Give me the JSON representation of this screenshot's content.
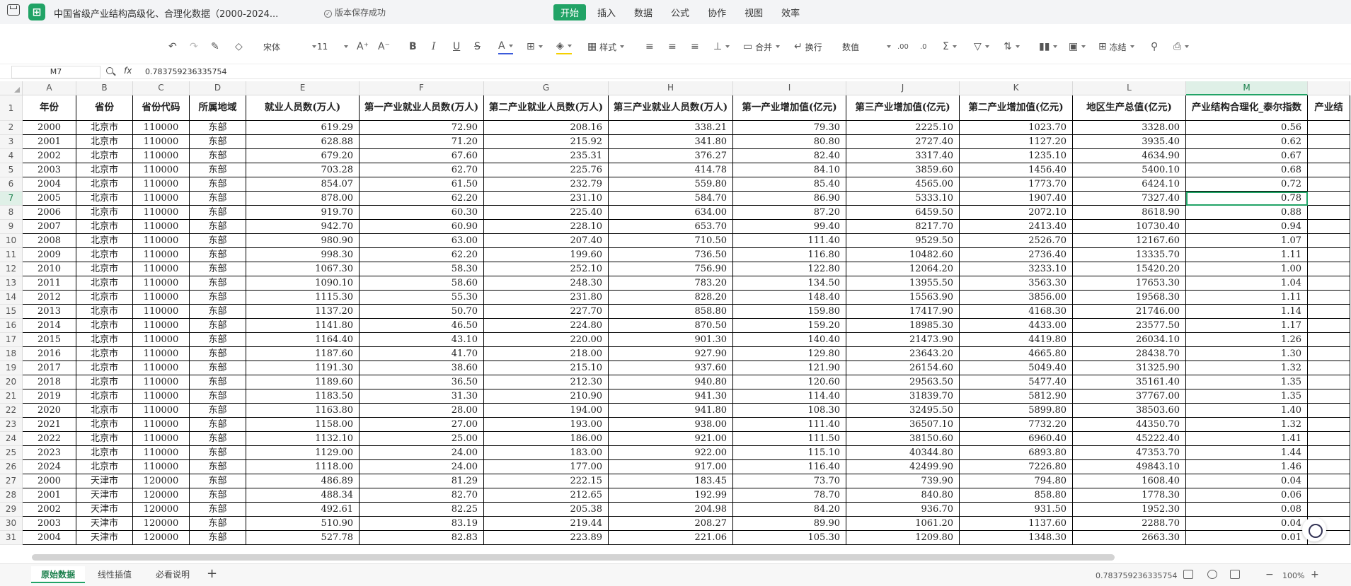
{
  "app": {
    "doc_title": "中国省级产业结构高级化、合理化数据（2000-2024...",
    "save_status": "版本保存成功"
  },
  "menu": [
    "开始",
    "插入",
    "数据",
    "公式",
    "协作",
    "视图",
    "效率"
  ],
  "menu_active": "开始",
  "toolbar": {
    "font_name": "宋体",
    "font_size": "11",
    "style_label": "样式",
    "merge_label": "合并",
    "wrap_label": "换行",
    "format_label": "数值",
    "freeze_label": "冻结"
  },
  "formula_bar": {
    "cell_ref": "M7",
    "fx": "fx",
    "value": "0.783759236335754"
  },
  "columns": [
    "A",
    "B",
    "C",
    "D",
    "E",
    "F",
    "G",
    "H",
    "I",
    "J",
    "K",
    "L",
    "M"
  ],
  "selected_column": "M",
  "header_row": [
    "年份",
    "省份",
    "省份代码",
    "所属地域",
    "就业人员数(万人)",
    "第一产业就业人员数(万人)",
    "第二产业就业人员数(万人)",
    "第三产业就业人员数(万人)",
    "第一产业增加值(亿元)",
    "第三产业增加值(亿元)",
    "第二产业增加值(亿元)",
    "地区生产总值(亿元)",
    "产业结构合理化_泰尔指数",
    "产业结"
  ],
  "rows": [
    [
      "2000",
      "北京市",
      "110000",
      "东部",
      "619.29",
      "72.90",
      "208.16",
      "338.21",
      "79.30",
      "2225.10",
      "1023.70",
      "3328.00",
      "0.56"
    ],
    [
      "2001",
      "北京市",
      "110000",
      "东部",
      "628.88",
      "71.20",
      "215.92",
      "341.80",
      "80.80",
      "2727.40",
      "1127.20",
      "3935.40",
      "0.62"
    ],
    [
      "2002",
      "北京市",
      "110000",
      "东部",
      "679.20",
      "67.60",
      "235.31",
      "376.27",
      "82.40",
      "3317.40",
      "1235.10",
      "4634.90",
      "0.67"
    ],
    [
      "2003",
      "北京市",
      "110000",
      "东部",
      "703.28",
      "62.70",
      "225.76",
      "414.78",
      "84.10",
      "3859.60",
      "1456.40",
      "5400.10",
      "0.68"
    ],
    [
      "2004",
      "北京市",
      "110000",
      "东部",
      "854.07",
      "61.50",
      "232.79",
      "559.80",
      "85.40",
      "4565.00",
      "1773.70",
      "6424.10",
      "0.72"
    ],
    [
      "2005",
      "北京市",
      "110000",
      "东部",
      "878.00",
      "62.20",
      "231.10",
      "584.70",
      "86.90",
      "5333.10",
      "1907.40",
      "7327.40",
      "0.78"
    ],
    [
      "2006",
      "北京市",
      "110000",
      "东部",
      "919.70",
      "60.30",
      "225.40",
      "634.00",
      "87.20",
      "6459.50",
      "2072.10",
      "8618.90",
      "0.88"
    ],
    [
      "2007",
      "北京市",
      "110000",
      "东部",
      "942.70",
      "60.90",
      "228.10",
      "653.70",
      "99.40",
      "8217.70",
      "2413.40",
      "10730.40",
      "0.94"
    ],
    [
      "2008",
      "北京市",
      "110000",
      "东部",
      "980.90",
      "63.00",
      "207.40",
      "710.50",
      "111.40",
      "9529.50",
      "2526.70",
      "12167.60",
      "1.07"
    ],
    [
      "2009",
      "北京市",
      "110000",
      "东部",
      "998.30",
      "62.20",
      "199.60",
      "736.50",
      "116.80",
      "10482.60",
      "2736.40",
      "13335.70",
      "1.11"
    ],
    [
      "2010",
      "北京市",
      "110000",
      "东部",
      "1067.30",
      "58.30",
      "252.10",
      "756.90",
      "122.80",
      "12064.20",
      "3233.10",
      "15420.20",
      "1.00"
    ],
    [
      "2011",
      "北京市",
      "110000",
      "东部",
      "1090.10",
      "58.60",
      "248.30",
      "783.20",
      "134.50",
      "13955.50",
      "3563.30",
      "17653.30",
      "1.04"
    ],
    [
      "2012",
      "北京市",
      "110000",
      "东部",
      "1115.30",
      "55.30",
      "231.80",
      "828.20",
      "148.40",
      "15563.90",
      "3856.00",
      "19568.30",
      "1.11"
    ],
    [
      "2013",
      "北京市",
      "110000",
      "东部",
      "1137.20",
      "50.70",
      "227.70",
      "858.80",
      "159.80",
      "17417.90",
      "4168.30",
      "21746.00",
      "1.14"
    ],
    [
      "2014",
      "北京市",
      "110000",
      "东部",
      "1141.80",
      "46.50",
      "224.80",
      "870.50",
      "159.20",
      "18985.30",
      "4433.00",
      "23577.50",
      "1.17"
    ],
    [
      "2015",
      "北京市",
      "110000",
      "东部",
      "1164.40",
      "43.10",
      "220.00",
      "901.30",
      "140.40",
      "21473.90",
      "4419.80",
      "26034.10",
      "1.26"
    ],
    [
      "2016",
      "北京市",
      "110000",
      "东部",
      "1187.60",
      "41.70",
      "218.00",
      "927.90",
      "129.80",
      "23643.20",
      "4665.80",
      "28438.70",
      "1.30"
    ],
    [
      "2017",
      "北京市",
      "110000",
      "东部",
      "1191.30",
      "38.60",
      "215.10",
      "937.60",
      "121.90",
      "26154.60",
      "5049.40",
      "31325.90",
      "1.32"
    ],
    [
      "2018",
      "北京市",
      "110000",
      "东部",
      "1189.60",
      "36.50",
      "212.30",
      "940.80",
      "120.60",
      "29563.50",
      "5477.40",
      "35161.40",
      "1.35"
    ],
    [
      "2019",
      "北京市",
      "110000",
      "东部",
      "1183.50",
      "31.30",
      "210.90",
      "941.30",
      "114.40",
      "31839.70",
      "5812.90",
      "37767.00",
      "1.35"
    ],
    [
      "2020",
      "北京市",
      "110000",
      "东部",
      "1163.80",
      "28.00",
      "194.00",
      "941.80",
      "108.30",
      "32495.50",
      "5899.80",
      "38503.60",
      "1.40"
    ],
    [
      "2021",
      "北京市",
      "110000",
      "东部",
      "1158.00",
      "27.00",
      "193.00",
      "938.00",
      "111.40",
      "36507.10",
      "7732.20",
      "44350.70",
      "1.32"
    ],
    [
      "2022",
      "北京市",
      "110000",
      "东部",
      "1132.10",
      "25.00",
      "186.00",
      "921.00",
      "111.50",
      "38150.60",
      "6960.40",
      "45222.40",
      "1.41"
    ],
    [
      "2023",
      "北京市",
      "110000",
      "东部",
      "1129.00",
      "24.00",
      "183.00",
      "922.00",
      "115.10",
      "40344.80",
      "6893.80",
      "47353.70",
      "1.44"
    ],
    [
      "2024",
      "北京市",
      "110000",
      "东部",
      "1118.00",
      "24.00",
      "177.00",
      "917.00",
      "116.40",
      "42499.90",
      "7226.80",
      "49843.10",
      "1.46"
    ],
    [
      "2000",
      "天津市",
      "120000",
      "东部",
      "486.89",
      "81.29",
      "222.15",
      "183.45",
      "73.70",
      "739.90",
      "794.80",
      "1608.40",
      "0.04"
    ],
    [
      "2001",
      "天津市",
      "120000",
      "东部",
      "488.34",
      "82.70",
      "212.65",
      "192.99",
      "78.70",
      "840.80",
      "858.80",
      "1778.30",
      "0.06"
    ],
    [
      "2002",
      "天津市",
      "120000",
      "东部",
      "492.61",
      "82.25",
      "205.38",
      "204.98",
      "84.20",
      "936.70",
      "931.50",
      "1952.30",
      "0.08"
    ],
    [
      "2003",
      "天津市",
      "120000",
      "东部",
      "510.90",
      "83.19",
      "219.44",
      "208.27",
      "89.90",
      "1061.20",
      "1137.60",
      "2288.70",
      "0.04"
    ],
    [
      "2004",
      "天津市",
      "120000",
      "东部",
      "527.78",
      "82.83",
      "223.89",
      "221.06",
      "105.30",
      "1209.80",
      "1348.30",
      "2663.30",
      "0.01"
    ]
  ],
  "selected_row": 7,
  "sheet_tabs": [
    "原始数据",
    "线性插值",
    "必看说明"
  ],
  "active_tab": "原始数据",
  "status": {
    "value": "0.783759236335754",
    "zoom": "100%"
  },
  "colors": {
    "accent": "#21a366"
  }
}
